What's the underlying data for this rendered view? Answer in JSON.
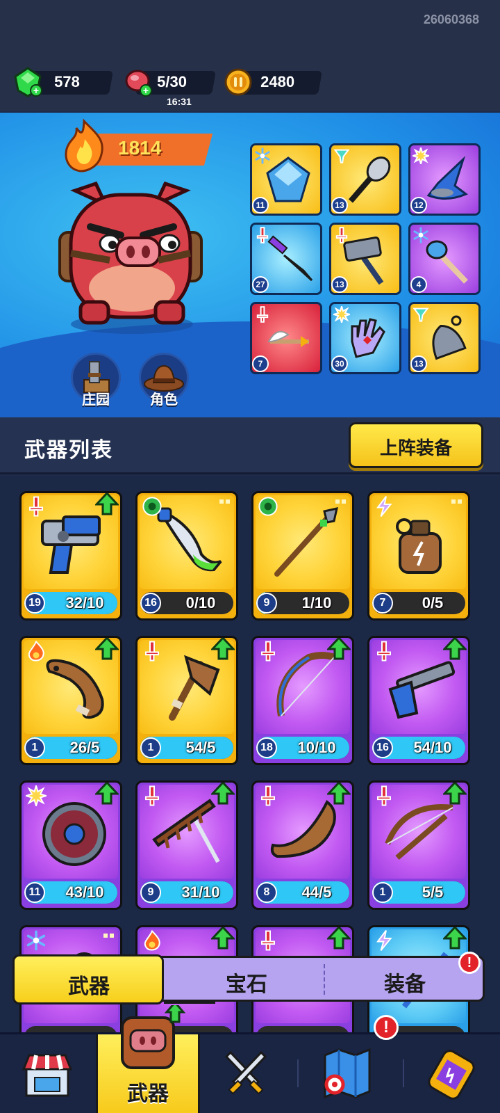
{
  "build_id": "26060368",
  "currency": {
    "gems": "578",
    "meat": "5/30",
    "meat_timer": "16:31",
    "coins": "2480"
  },
  "hero": {
    "power": "1814",
    "manor_label": "庄园",
    "character_label": "角色",
    "equipped": [
      {
        "name": "ice-crystal",
        "level": "11",
        "bg": "yellow",
        "type": "snowflake"
      },
      {
        "name": "spiked-club",
        "level": "13",
        "bg": "yellow",
        "type": "tornado"
      },
      {
        "name": "wizard-hat",
        "level": "12",
        "bg": "purple",
        "type": "burst"
      },
      {
        "name": "dagger",
        "level": "27",
        "bg": "blue",
        "type": "sword"
      },
      {
        "name": "hammer",
        "level": "13",
        "bg": "yellow",
        "type": "sword"
      },
      {
        "name": "ice-torch",
        "level": "4",
        "bg": "purple",
        "type": "snowflake"
      },
      {
        "name": "winged-arrow",
        "level": "7",
        "bg": "red",
        "type": "sword"
      },
      {
        "name": "gem-glove",
        "level": "30",
        "bg": "blue",
        "type": "burst"
      },
      {
        "name": "bell",
        "level": "13",
        "bg": "yellow",
        "type": "tornado"
      }
    ]
  },
  "weapon_list": {
    "title": "武器列表",
    "deploy_button": "上阵装备",
    "items": [
      {
        "name": "blaster",
        "level": "19",
        "progress": "32/10",
        "fill": 1.0,
        "bg": "yellow",
        "type": "sword",
        "upgradable": true
      },
      {
        "name": "poison-blade",
        "level": "16",
        "progress": "0/10",
        "fill": 0.0,
        "bg": "yellow",
        "type": "poison",
        "upgradable": false
      },
      {
        "name": "spear",
        "level": "9",
        "progress": "1/10",
        "fill": 0.1,
        "bg": "yellow",
        "type": "poison",
        "upgradable": false
      },
      {
        "name": "thunder-flask",
        "level": "7",
        "progress": "0/5",
        "fill": 0.0,
        "bg": "yellow",
        "type": "lightning",
        "upgradable": false
      },
      {
        "name": "horn",
        "level": "1",
        "progress": "26/5",
        "fill": 1.0,
        "bg": "yellow",
        "type": "fire",
        "upgradable": true
      },
      {
        "name": "axe",
        "level": "1",
        "progress": "54/5",
        "fill": 1.0,
        "bg": "yellow",
        "type": "sword",
        "upgradable": true
      },
      {
        "name": "bow",
        "level": "18",
        "progress": "10/10",
        "fill": 1.0,
        "bg": "purple",
        "type": "sword",
        "upgradable": true
      },
      {
        "name": "pistol",
        "level": "16",
        "progress": "54/10",
        "fill": 1.0,
        "bg": "purple",
        "type": "sword",
        "upgradable": true
      },
      {
        "name": "shield",
        "level": "11",
        "progress": "43/10",
        "fill": 1.0,
        "bg": "purple",
        "type": "burst",
        "upgradable": true
      },
      {
        "name": "rake",
        "level": "9",
        "progress": "31/10",
        "fill": 1.0,
        "bg": "purple",
        "type": "sword",
        "upgradable": true
      },
      {
        "name": "boomerang",
        "level": "8",
        "progress": "44/5",
        "fill": 1.0,
        "bg": "purple",
        "type": "sword",
        "upgradable": true
      },
      {
        "name": "crossbow",
        "level": "1",
        "progress": "5/5",
        "fill": 1.0,
        "bg": "purple",
        "type": "sword",
        "upgradable": true
      },
      {
        "name": "frost-mace",
        "level": "",
        "progress": "",
        "fill": 0.0,
        "bg": "purple",
        "type": "snowflake",
        "upgradable": false
      },
      {
        "name": "fire-crate",
        "level": "",
        "progress": "",
        "fill": 0.0,
        "bg": "purple",
        "type": "fire",
        "upgradable": true
      },
      {
        "name": "horned-helm",
        "level": "",
        "progress": "",
        "fill": 0.0,
        "bg": "purple",
        "type": "sword",
        "upgradable": true
      },
      {
        "name": "thunder-staff",
        "level": "",
        "progress": "",
        "fill": 0.0,
        "bg": "blue",
        "type": "lightning",
        "upgradable": true
      }
    ]
  },
  "tabs": [
    {
      "label": "武器",
      "active": true
    },
    {
      "label": "宝石",
      "active": false
    },
    {
      "label": "装备",
      "active": false,
      "alert": "!"
    }
  ],
  "bottom_nav": [
    {
      "name": "shop"
    },
    {
      "name": "weapons",
      "label": "武器",
      "selected": true
    },
    {
      "name": "battle"
    },
    {
      "name": "map",
      "alert": "!"
    },
    {
      "name": "potion"
    }
  ]
}
